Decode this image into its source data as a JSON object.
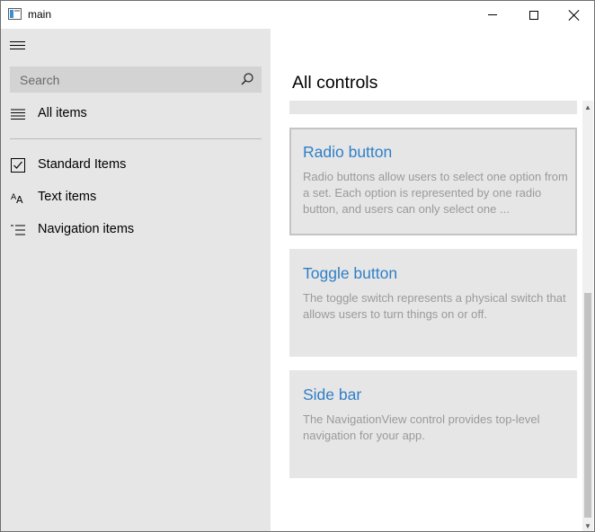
{
  "window": {
    "title": "main",
    "controls": {
      "minimize": "minimize",
      "maximize": "maximize",
      "close": "close"
    }
  },
  "sidebar": {
    "menu_icon": "hamburger-icon",
    "search": {
      "placeholder": "Search",
      "value": "",
      "icon": "search-icon"
    },
    "items": [
      {
        "label": "All items",
        "icon": "list-icon"
      },
      {
        "label": "Standard Items",
        "icon": "checkbox-icon"
      },
      {
        "label": "Text items",
        "icon": "font-size-icon"
      },
      {
        "label": "Navigation items",
        "icon": "bulleted-list-icon"
      }
    ]
  },
  "main": {
    "title": "All controls",
    "cards": [
      {
        "title": "",
        "description": ""
      },
      {
        "title": "Radio button",
        "description": "Radio buttons allow users to select one option from a set. Each option is represented by one radio button, and users can only select one ..."
      },
      {
        "title": "Toggle button",
        "description": "The toggle switch represents a physical switch that allows users to turn things on or off."
      },
      {
        "title": "Side bar",
        "description": "The NavigationView control provides top-level navigation for your app."
      }
    ]
  },
  "colors": {
    "sidebar_bg": "#e6e6e6",
    "card_bg": "#e6e6e6",
    "accent_title": "#2f7fc7",
    "muted_text": "#9a9a9a"
  }
}
